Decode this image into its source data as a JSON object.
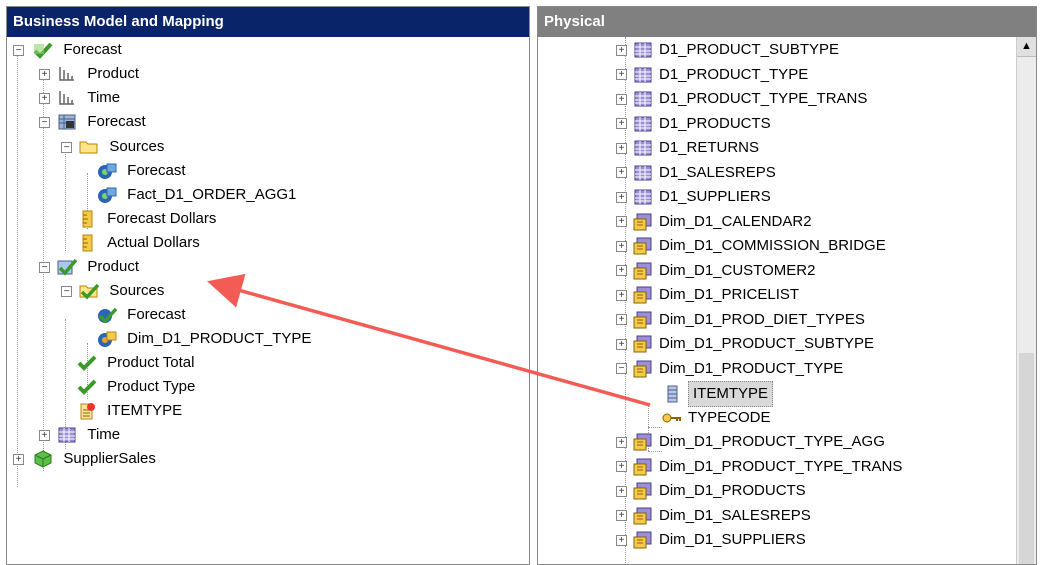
{
  "left_panel": {
    "title": "Business Model and Mapping",
    "items": [
      {
        "label": "Forecast",
        "icon": "business-model-icon"
      },
      {
        "label": "Product",
        "icon": "hierarchy-icon"
      },
      {
        "label": "Time",
        "icon": "hierarchy-icon"
      },
      {
        "label": "Forecast",
        "icon": "fact-table-icon"
      },
      {
        "label": "Sources",
        "icon": "folder-icon"
      },
      {
        "label": "Forecast",
        "icon": "logical-source-icon"
      },
      {
        "label": "Fact_D1_ORDER_AGG1",
        "icon": "logical-source-icon"
      },
      {
        "label": "Forecast Dollars",
        "icon": "measure-icon"
      },
      {
        "label": "Actual Dollars",
        "icon": "measure-icon"
      },
      {
        "label": "Product",
        "icon": "logical-table-icon"
      },
      {
        "label": "Sources",
        "icon": "sources-check-icon"
      },
      {
        "label": "Forecast",
        "icon": "logical-source-check-icon"
      },
      {
        "label": "Dim_D1_PRODUCT_TYPE",
        "icon": "logical-source-icon"
      },
      {
        "label": "Product Total",
        "icon": "check-icon"
      },
      {
        "label": "Product Type",
        "icon": "check-icon"
      },
      {
        "label": "ITEMTYPE",
        "icon": "new-column-icon"
      },
      {
        "label": "Time",
        "icon": "table-icon"
      },
      {
        "label": "SupplierSales",
        "icon": "business-model-cube-icon"
      }
    ]
  },
  "right_panel": {
    "title": "Physical",
    "items": [
      {
        "label": "D1_PRODUCT_SUBTYPE",
        "icon": "table-icon"
      },
      {
        "label": "D1_PRODUCT_TYPE",
        "icon": "table-icon"
      },
      {
        "label": "D1_PRODUCT_TYPE_TRANS",
        "icon": "table-icon"
      },
      {
        "label": "D1_PRODUCTS",
        "icon": "table-icon"
      },
      {
        "label": "D1_RETURNS",
        "icon": "table-icon"
      },
      {
        "label": "D1_SALESREPS",
        "icon": "table-icon"
      },
      {
        "label": "D1_SUPPLIERS",
        "icon": "table-icon"
      },
      {
        "label": "Dim_D1_CALENDAR2",
        "icon": "alias-table-icon"
      },
      {
        "label": "Dim_D1_COMMISSION_BRIDGE",
        "icon": "alias-table-icon"
      },
      {
        "label": "Dim_D1_CUSTOMER2",
        "icon": "alias-table-icon"
      },
      {
        "label": "Dim_D1_PRICELIST",
        "icon": "alias-table-icon"
      },
      {
        "label": "Dim_D1_PROD_DIET_TYPES",
        "icon": "alias-table-icon"
      },
      {
        "label": "Dim_D1_PRODUCT_SUBTYPE",
        "icon": "alias-table-icon"
      },
      {
        "label": "Dim_D1_PRODUCT_TYPE",
        "icon": "alias-table-icon"
      },
      {
        "label": "ITEMTYPE",
        "icon": "column-icon"
      },
      {
        "label": "TYPECODE",
        "icon": "key-icon"
      },
      {
        "label": "Dim_D1_PRODUCT_TYPE_AGG",
        "icon": "alias-table-icon"
      },
      {
        "label": "Dim_D1_PRODUCT_TYPE_TRANS",
        "icon": "alias-table-icon"
      },
      {
        "label": "Dim_D1_PRODUCTS",
        "icon": "alias-table-icon"
      },
      {
        "label": "Dim_D1_SALESREPS",
        "icon": "alias-table-icon"
      },
      {
        "label": "Dim_D1_SUPPLIERS",
        "icon": "alias-table-icon"
      }
    ]
  },
  "colors": {
    "arrow": "#f25c54",
    "selected_header": "#0a246a",
    "inactive_header": "#808080"
  }
}
